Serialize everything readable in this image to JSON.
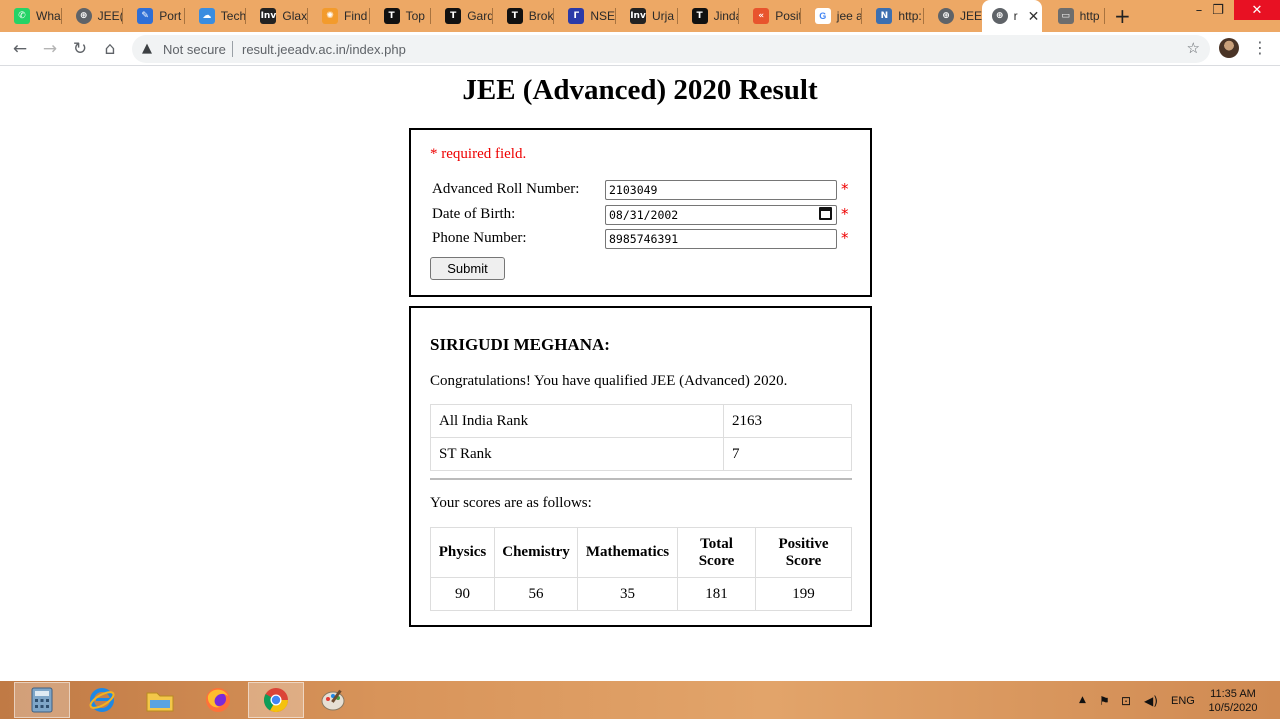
{
  "browser": {
    "tabs": [
      {
        "label": "Wha",
        "icon": "whatsapp-icon",
        "color": "#25d366",
        "glyph": "✆"
      },
      {
        "label": "JEE(/",
        "icon": "globe-icon",
        "color": "#5f6368",
        "glyph": "⊕"
      },
      {
        "label": "Port",
        "icon": "portal-icon",
        "color": "#2f6fd6",
        "glyph": "✎"
      },
      {
        "label": "Tech",
        "icon": "cloud-icon",
        "color": "#3a8de0",
        "glyph": "☁"
      },
      {
        "label": "Glax",
        "icon": "inv-icon",
        "color": "#222222",
        "glyph": "Inv"
      },
      {
        "label": "Find",
        "icon": "sun-icon",
        "color": "#f39b2c",
        "glyph": "✺"
      },
      {
        "label": "Top",
        "icon": "t-icon",
        "color": "#111111",
        "glyph": "T"
      },
      {
        "label": "Gard",
        "icon": "t-icon",
        "color": "#111111",
        "glyph": "T"
      },
      {
        "label": "Brok",
        "icon": "t-icon",
        "color": "#111111",
        "glyph": "T"
      },
      {
        "label": "NSE",
        "icon": "nse-icon",
        "color": "#2b3aa8",
        "glyph": "Γ"
      },
      {
        "label": "Urja",
        "icon": "inv-icon",
        "color": "#222222",
        "glyph": "Inv"
      },
      {
        "label": "Jinda",
        "icon": "t-icon",
        "color": "#111111",
        "glyph": "T"
      },
      {
        "label": "Posit",
        "icon": "chevron-icon",
        "color": "#e8542d",
        "glyph": "«"
      },
      {
        "label": "jee a",
        "icon": "google-icon",
        "color": "#ffffff",
        "glyph": "G"
      },
      {
        "label": "http:",
        "icon": "nic-icon",
        "color": "#3c6fb0",
        "glyph": "N"
      },
      {
        "label": "JEE(/",
        "icon": "globe-icon",
        "color": "#5f6368",
        "glyph": "⊕"
      },
      {
        "label": "r",
        "icon": "globe-icon",
        "color": "#5f6368",
        "glyph": "⊕",
        "active": true
      },
      {
        "label": "http",
        "icon": "monitor-icon",
        "color": "#6d6d6d",
        "glyph": "▭"
      }
    ],
    "not_secure": "Not secure",
    "url": "result.jeeadv.ac.in/index.php"
  },
  "page": {
    "title": "JEE (Advanced) 2020 Result",
    "required_note": "* required field.",
    "fields": {
      "roll_label": "Advanced Roll Number:",
      "roll_value": "2103049",
      "dob_label": "Date of Birth:",
      "dob_value": "08/31/2002",
      "phone_label": "Phone Number:",
      "phone_value": "8985746391",
      "required_mark": "*"
    },
    "submit_label": "Submit",
    "result": {
      "candidate_name": "SIRIGUDI MEGHANA:",
      "message": "Congratulations! You have qualified JEE (Advanced) 2020.",
      "ranks": [
        {
          "label": "All India Rank",
          "value": "2163"
        },
        {
          "label": "ST Rank",
          "value": "7"
        }
      ],
      "scores_intro": "Your scores are as follows:",
      "score_headers": [
        "Physics",
        "Chemistry",
        "Mathematics",
        "Total Score",
        "Positive Score"
      ],
      "score_values": [
        "90",
        "56",
        "35",
        "181",
        "199"
      ]
    }
  },
  "taskbar": {
    "language": "ENG",
    "time": "11:35 AM",
    "date": "10/5/2020"
  }
}
